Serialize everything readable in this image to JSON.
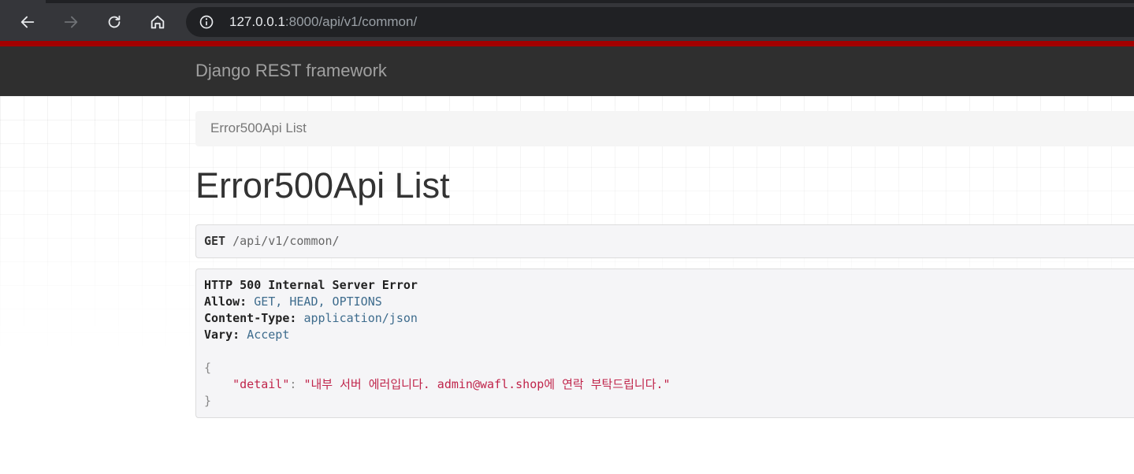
{
  "browser": {
    "url_host": "127.0.0.1",
    "url_rest": ":8000/api/v1/common/"
  },
  "navbar": {
    "brand": "Django REST framework"
  },
  "breadcrumb": {
    "current": "Error500Api List"
  },
  "page": {
    "title": "Error500Api List"
  },
  "request": {
    "method": "GET",
    "path": "/api/v1/common/"
  },
  "response": {
    "status_line": "HTTP 500 Internal Server Error",
    "headers": [
      {
        "name": "Allow:",
        "value": "GET, HEAD, OPTIONS"
      },
      {
        "name": "Content-Type:",
        "value": "application/json"
      },
      {
        "name": "Vary:",
        "value": "Accept"
      }
    ],
    "body_open": "{",
    "body_key": "\"detail\"",
    "body_sep": ": ",
    "body_value": "\"내부 서버 에러입니다. admin@wafl.shop에 연락 부탁드립니다.\"",
    "body_close": "}"
  },
  "colors": {
    "navbar_bg": "#2f2f2f",
    "navbar_accent": "#a30000",
    "header_value": "#3e6c8d",
    "string_value": "#c0254b"
  }
}
